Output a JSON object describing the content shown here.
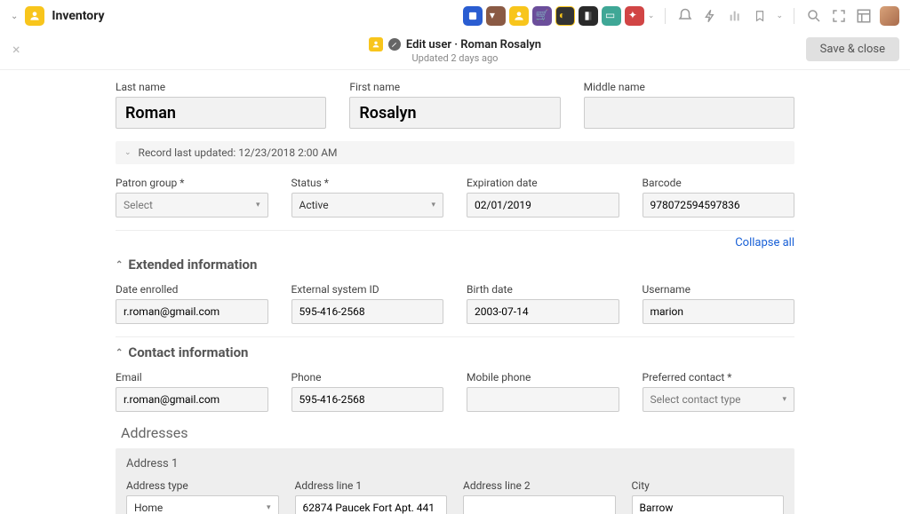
{
  "topbar": {
    "app_name": "Inventory"
  },
  "subheader": {
    "title": "Edit user · Roman Rosalyn",
    "updated": "Updated 2 days ago",
    "save_label": "Save & close"
  },
  "identity": {
    "last_name_label": "Last name",
    "last_name": "Roman",
    "first_name_label": "First name",
    "first_name": "Rosalyn",
    "middle_name_label": "Middle name",
    "middle_name": ""
  },
  "record_bar": "Record last updated: 12/23/2018 2:00 AM",
  "patron": {
    "group_label": "Patron group *",
    "group_placeholder": "Select",
    "status_label": "Status *",
    "status_value": "Active",
    "expiration_label": "Expiration date",
    "expiration_value": "02/01/2019",
    "barcode_label": "Barcode",
    "barcode_value": "978072594597836"
  },
  "collapse_all": "Collapse all",
  "ext": {
    "section": "Extended information",
    "date_enrolled_label": "Date enrolled",
    "date_enrolled_value": "r.roman@gmail.com",
    "external_id_label": "External system ID",
    "external_id_value": "595-416-2568",
    "birth_label": "Birth date",
    "birth_value": "2003-07-14",
    "username_label": "Username",
    "username_value": "marion"
  },
  "contact": {
    "section": "Contact information",
    "email_label": "Email",
    "email_value": "r.roman@gmail.com",
    "phone_label": "Phone",
    "phone_value": "595-416-2568",
    "mobile_label": "Mobile phone",
    "mobile_value": "",
    "preferred_label": "Preferred contact *",
    "preferred_placeholder": "Select contact type"
  },
  "addresses": {
    "title": "Addresses",
    "card_title": "Address 1",
    "type_label": "Address type",
    "type_value": "Home",
    "line1_label": "Address line 1",
    "line1_value": "62874 Paucek Fort Apt. 441",
    "line2_label": "Address line 2",
    "line2_value": "",
    "city_label": "City",
    "city_value": "Barrow"
  }
}
